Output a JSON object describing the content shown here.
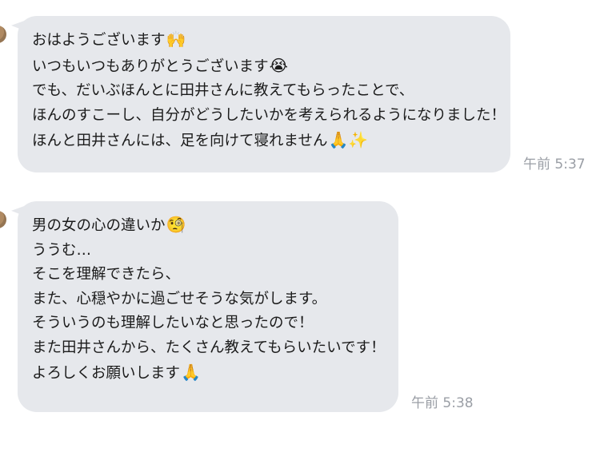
{
  "messages": [
    {
      "lines": [
        {
          "text": "おはようございます",
          "emoji": "🙌"
        },
        {
          "text": "いつもいつもありがとうございます",
          "emoji": "😭"
        },
        {
          "text": "でも、だいぶほんとに田井さんに教えてもらったことで、",
          "emoji": ""
        },
        {
          "text": "ほんのすこーし、自分がどうしたいかを考えられるようになりました！",
          "emoji": ""
        },
        {
          "text": "ほんと田井さんには、足を向けて寝れません",
          "emoji": "🙏✨"
        }
      ],
      "time": "午前 5:37"
    },
    {
      "lines": [
        {
          "text": "男の女の心の違いか",
          "emoji": "🧐"
        },
        {
          "text": "ううむ…",
          "emoji": ""
        },
        {
          "text": "そこを理解できたら、",
          "emoji": ""
        },
        {
          "text": "また、心穏やかに過ごせそうな気がします。",
          "emoji": ""
        },
        {
          "text": "そういうのも理解したいなと思ったので！",
          "emoji": ""
        },
        {
          "text": "また田井さんから、たくさん教えてもらいたいです！",
          "emoji": ""
        },
        {
          "text": "よろしくお願いします",
          "emoji": "🙏"
        }
      ],
      "time": "午前 5:38"
    }
  ]
}
